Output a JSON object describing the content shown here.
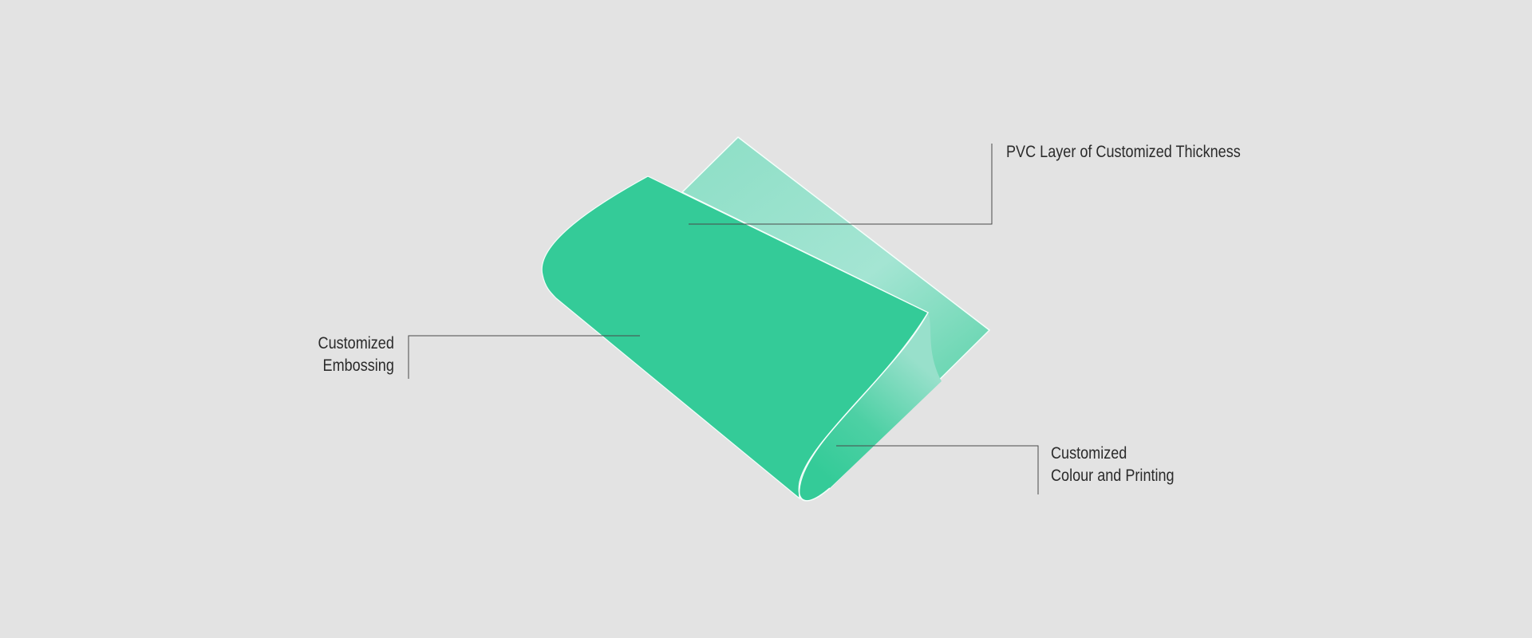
{
  "colors": {
    "background": "#e3e3e3",
    "sheet_front": "#34cb98",
    "sheet_back_light": "#9fe2d0",
    "sheet_back_mid": "#5fd4ad",
    "edge_highlight": "#f4fffb",
    "leader_line": "#4a4a4a",
    "text": "#2b2b2b"
  },
  "callouts": {
    "pvc_layer": {
      "lines": [
        "PVC Layer of Customized Thickness"
      ]
    },
    "embossing": {
      "lines": [
        "Customized",
        "Embossing"
      ]
    },
    "colour_printing": {
      "lines": [
        "Customized",
        "Colour and Printing"
      ]
    }
  }
}
